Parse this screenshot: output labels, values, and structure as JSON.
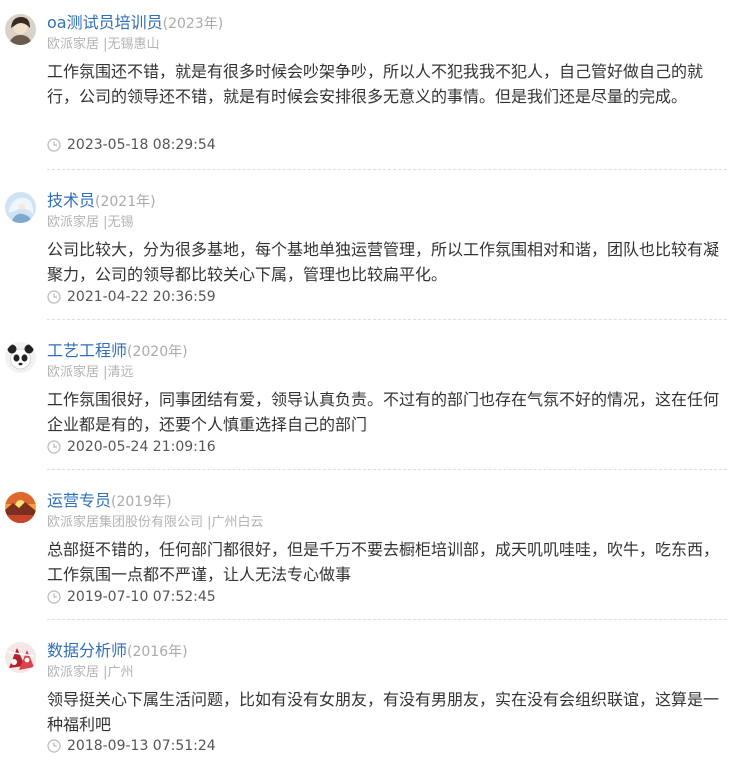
{
  "reviews": [
    {
      "job_title": "oa测试员培训员",
      "year": "(2023年)",
      "company": "欧派家居 |无锡惠山",
      "content": "工作氛围还不错，就是有很多时候会吵架争吵，所以人不犯我我不犯人，自己管好做自己的就行，公司的领导还不错，就是有时候会安排很多无意义的事情。但是我们还是尽量的完成。",
      "datetime": "2023-05-18 08:29:54",
      "avatar_icon": "avatar-girl-icon"
    },
    {
      "job_title": "技术员",
      "year": "(2021年)",
      "company": "欧派家居 |无锡",
      "content": "公司比较大，分为很多基地，每个基地单独运营管理，所以工作氛围相对和谐，团队也比较有凝聚力，公司的领导都比较关心下属，管理也比较扁平化。",
      "datetime": "2021-04-22 20:36:59",
      "avatar_icon": "avatar-anime-icon"
    },
    {
      "job_title": "工艺工程师",
      "year": "(2020年)",
      "company": "欧派家居 |清远",
      "content": "工作氛围很好，同事团结有爱，领导认真负责。不过有的部门也存在气氛不好的情况，这在任何企业都是有的，还要个人慎重选择自己的部门",
      "datetime": "2020-05-24 21:09:16",
      "avatar_icon": "avatar-panda-icon"
    },
    {
      "job_title": "运营专员",
      "year": "(2019年)",
      "company": "欧派家居集团股份有限公司 |广州白云",
      "content": "总部挺不错的，任何部门都很好，但是千万不要去橱柜培训部，成天叽叽哇哇，吹牛，吃东西，工作氛围一点都不严谨，让人无法专心做事",
      "datetime": "2019-07-10 07:52:45",
      "avatar_icon": "avatar-sunset-icon"
    },
    {
      "job_title": "数据分析师",
      "year": "(2016年)",
      "company": "欧派家居 |广州",
      "content": "领导挺关心下属生活问题，比如有没有女朋友，有没有男朋友，实在没有会组织联谊，这算是一种福利吧",
      "datetime": "2018-09-13 07:51:24",
      "avatar_icon": "avatar-red-pattern-icon"
    }
  ],
  "colors": {
    "job_title": "#2f6fb8",
    "meta": "#b3b3b3",
    "content": "#333333",
    "divider": "#dddddd"
  }
}
